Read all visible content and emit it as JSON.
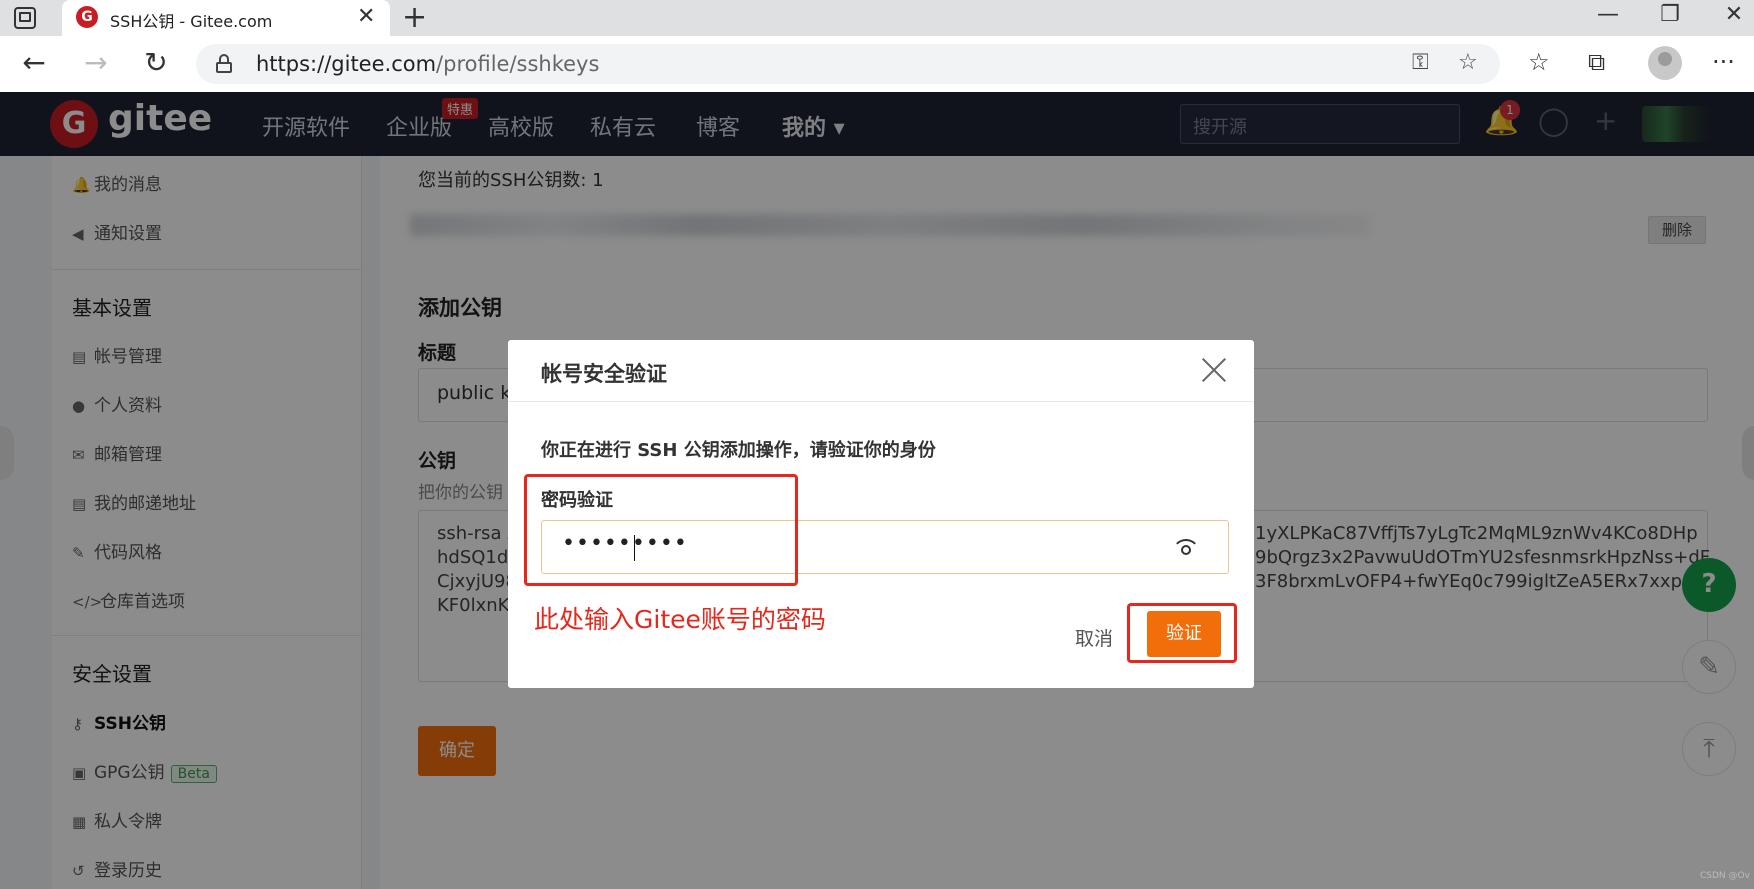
{
  "browser": {
    "tab_title": "SSH公钥 - Gitee.com",
    "tab_favicon": "G",
    "tab_close": "✕",
    "new_tab": "+",
    "window": {
      "minimize": "—",
      "restore": "❐",
      "close": "✕"
    },
    "url_host": "https://gitee.com",
    "url_path": "/profile/sshkeys",
    "icons": {
      "back": "←",
      "forward": "→",
      "refresh": "↻",
      "key": "⚿",
      "favorite": "☆",
      "favorites": "☆",
      "collections": "⧉",
      "more": "···"
    }
  },
  "header": {
    "logo_letter": "G",
    "logo_text": "gitee",
    "nav": [
      "开源软件",
      "企业版",
      "高校版",
      "私有云",
      "博客",
      "我的 ▾"
    ],
    "enterprise_badge": "特惠",
    "search_placeholder": "搜开源",
    "notification_count": "1",
    "icons": {
      "bell": "🔔",
      "bulb": "◯",
      "plus": "+"
    }
  },
  "sidebar": {
    "items_top": [
      {
        "icon": "🔔",
        "label": "我的消息"
      },
      {
        "icon": "◀",
        "label": "通知设置"
      }
    ],
    "section_basic": "基本设置",
    "items_basic": [
      {
        "icon": "▤",
        "label": "帐号管理"
      },
      {
        "icon": "●",
        "label": "个人资料"
      },
      {
        "icon": "✉",
        "label": "邮箱管理"
      },
      {
        "icon": "▤",
        "label": "我的邮递地址"
      },
      {
        "icon": "✎",
        "label": "代码风格"
      },
      {
        "icon": "</>",
        "label": "仓库首选项"
      }
    ],
    "section_security": "安全设置",
    "items_security": [
      {
        "icon": "⚷",
        "label": "SSH公钥"
      },
      {
        "icon": "▣",
        "label": "GPG公钥"
      },
      {
        "icon": "▦",
        "label": "私人令牌"
      },
      {
        "icon": "↺",
        "label": "登录历史"
      }
    ],
    "gpg_badge": "Beta"
  },
  "main": {
    "key_count_text": "您当前的SSH公钥数: 1",
    "delete_label": "删除",
    "add_key_title": "添加公钥",
    "title_label": "标题",
    "title_value": "public k",
    "pubkey_label": "公钥",
    "pubkey_hint": "把你的公钥",
    "key_lines_left": [
      "ssh-rsa A",
      "hdSQ1d",
      "CjxyjU98",
      "KF0lxnK"
    ],
    "key_lines_right": [
      "1yXLPKaC87VffjTs7yLgTc2MqML9znWv4KCo8DHp",
      "9bQrgz3x2PavwuUdOTmYU2sfesnmsrkHpzNss+dF",
      "3F8brxmLvOFP4+fwYEq0c799igltZeA5ERx7xxp4hd"
    ],
    "confirm_label": "确定"
  },
  "floating": {
    "help": "?",
    "feedback": "✎",
    "top": "⤒"
  },
  "modal": {
    "title": "帐号安全验证",
    "description": "你正在进行 SSH 公钥添加操作，请验证你的身份",
    "password_label": "密码验证",
    "password_value": "•••••••••",
    "cancel_label": "取消",
    "verify_label": "验证"
  },
  "annotation": {
    "text": "此处输入Gitee账号的密码",
    "color": "#e5281b"
  },
  "watermark": "CSDN @Ov",
  "colors": {
    "brand": "#c71d23",
    "accent": "#f26e0b",
    "header_bg": "#1e2333"
  }
}
